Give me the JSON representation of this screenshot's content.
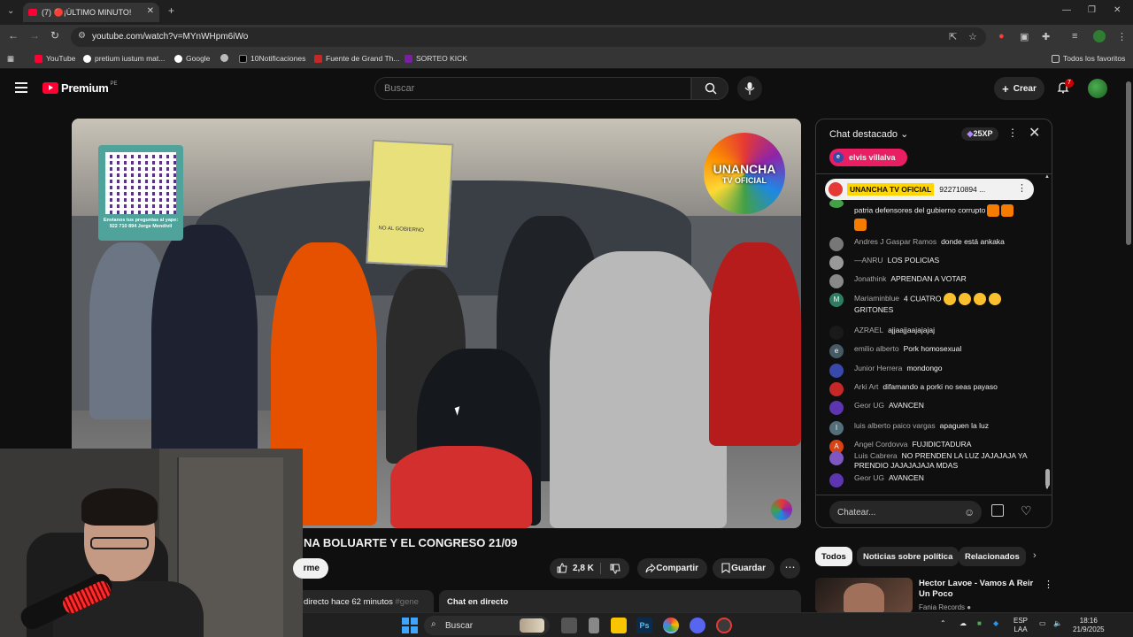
{
  "browser": {
    "tab_title": "(7) 🔴¡ÚLTIMO MINUTO! M",
    "url": "youtube.com/watch?v=MYnWHpm6iWo",
    "bookmarks": [
      "YouTube",
      "pretium iustum mat...",
      "Google",
      "",
      "10Notificaciones",
      "Fuente de Grand Th...",
      "SORTEO KICK"
    ],
    "all_favorites": "Todos los favoritos"
  },
  "youtube": {
    "logo": "Premium",
    "logo_country": "PE",
    "search_placeholder": "Buscar",
    "create_label": "Crear",
    "notif_count": "7"
  },
  "video": {
    "qr_caption": "Envíanos tus preguntas al yape: 922 710 894 Jorge Mendivil",
    "watermark_line1": "UNANCHA",
    "watermark_line2": "TV OFICIAL",
    "title": "NA BOLUARTE Y EL CONGRESO 21/09",
    "report_label": "rme",
    "likes": "2,8 K",
    "share_label": "Compartir",
    "save_label": "Guardar",
    "desc_text": "directo hace 62 minutos",
    "desc_tag": "#gene",
    "chat_replay_label": "Chat en directo"
  },
  "chat": {
    "title": "Chat destacado",
    "xp": "25XP",
    "highlight_user": "elvis villalva",
    "highlight_user_initial": "e",
    "pinned": {
      "name": "UNANCHA TV OFICIAL",
      "message": "922710894 ..."
    },
    "messages": [
      {
        "name": "",
        "text": "patria defensores del gubierno corrupto",
        "avatar_color": "#43a047",
        "initial": ""
      },
      {
        "name": "Andres J Gaspar Ramos",
        "text": "donde está ankaka",
        "avatar_color": "#777777",
        "initial": ""
      },
      {
        "name": "—ANRU",
        "text": "LOS POLICIAS",
        "avatar_color": "#999999",
        "initial": ""
      },
      {
        "name": "Jonathink",
        "text": "APRENDAN A VOTAR",
        "avatar_color": "#888888",
        "initial": ""
      },
      {
        "name": "Mariaminblue",
        "text": "4 CUATRO",
        "text2": "GRITONES",
        "avatar_color": "#2e7d62",
        "initial": "M"
      },
      {
        "name": "AZRAEL",
        "text": "ajjaajjaajajajaj",
        "avatar_color": "#1a1a1a",
        "initial": ""
      },
      {
        "name": "emilio alberto",
        "text": "Pork homosexual",
        "avatar_color": "#455a64",
        "initial": "e"
      },
      {
        "name": "Junior Herrera",
        "text": "mondongo",
        "avatar_color": "#3949ab",
        "initial": ""
      },
      {
        "name": "Arki Art",
        "text": "difamando a porki no seas payaso",
        "avatar_color": "#c62828",
        "initial": ""
      },
      {
        "name": "Geor UG",
        "text": "AVANCEN",
        "avatar_color": "#5e35b1",
        "initial": ""
      },
      {
        "name": "luis alberto paico vargas",
        "text": "apaguen la luz",
        "avatar_color": "#546e7a",
        "initial": "l"
      },
      {
        "name": "Angel Cordovva",
        "text": "FUJIDICTADURA",
        "avatar_color": "#d84315",
        "initial": "A"
      },
      {
        "name": "Luis Cabrera",
        "text": "NO PRENDEN LA LUZ JAJAJAJA YA PRENDIO JAJAJAJAJA MDAS",
        "avatar_color": "#7e57c2",
        "initial": ""
      },
      {
        "name": "Geor UG",
        "text": "AVANCEN",
        "avatar_color": "#5e35b1",
        "initial": ""
      }
    ],
    "input_placeholder": "Chatear..."
  },
  "chips": [
    "Todos",
    "Noticias sobre política",
    "Relacionados"
  ],
  "recommendation": {
    "title": "Hector Lavoe - Vamos A Reir Un Poco",
    "channel": "Fania Records"
  },
  "taskbar": {
    "search_label": "Buscar",
    "lang1": "ESP",
    "lang2": "LAA",
    "time": "18:16",
    "date": "21/9/2025"
  }
}
